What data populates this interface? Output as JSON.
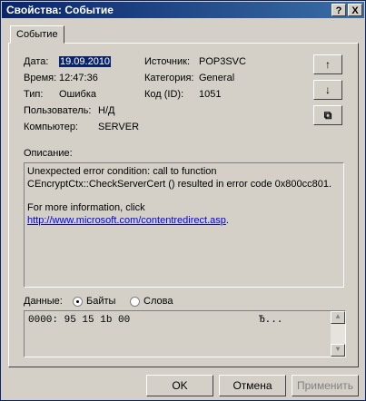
{
  "window": {
    "title": "Свойства: Событие",
    "help_label": "?",
    "close_label": "X"
  },
  "tab": {
    "label": "Событие"
  },
  "info": {
    "date_label": "Дата:",
    "date_value": "19.09.2010",
    "time_label": "Время:",
    "time_value": "12:47:36",
    "type_label": "Тип:",
    "type_value": "Ошибка",
    "user_label": "Пользователь:",
    "user_value": "Н/Д",
    "computer_label": "Компьютер:",
    "computer_value": "SERVER",
    "source_label": "Источник:",
    "source_value": "POP3SVC",
    "category_label": "Категория:",
    "category_value": "General",
    "id_label": "Код (ID):",
    "id_value": "1051"
  },
  "side_buttons": {
    "up": "↑",
    "down": "↓",
    "copy": "⧉"
  },
  "description": {
    "label": "Описание:",
    "line1": "Unexpected error condition: call to function CEncryptCtx::CheckServerCert () resulted in error code 0x800cc801.",
    "line2_prefix": "For more information, click ",
    "link": "http://www.microsoft.com/contentredirect.asp",
    "line2_suffix": "."
  },
  "data_section": {
    "label": "Данные:",
    "bytes_label": "Байты",
    "words_label": "Слова",
    "selected": "bytes",
    "line": "0000: 95 15 1b 00",
    "ascii": "Ђ..."
  },
  "buttons": {
    "ok": "OK",
    "cancel": "Отмена",
    "apply": "Применить"
  }
}
